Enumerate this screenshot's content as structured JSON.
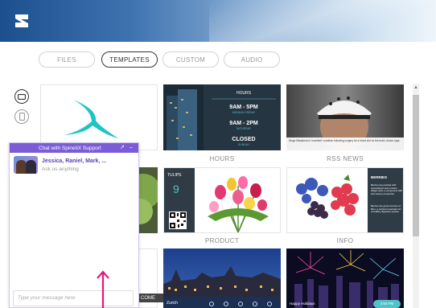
{
  "tabs": [
    {
      "label": "FILES",
      "active": false
    },
    {
      "label": "TEMPLATES",
      "active": true
    },
    {
      "label": "CUSTOM",
      "active": false
    },
    {
      "label": "AUDIO",
      "active": false
    }
  ],
  "side_icons": [
    "landscape-screen-icon",
    "portrait-screen-icon"
  ],
  "thumbs": {
    "hours": {
      "caption": "HOURS",
      "title": "HOURS",
      "row1": "9AM - 5PM",
      "row1_sub": "MONDAY-FRIDAY",
      "row2": "9AM - 2PM",
      "row2_sub": "SATURDAY",
      "row3": "CLOSED",
      "row3_sub": "SUNDAY"
    },
    "rss": {
      "caption": "RSS NEWS",
      "headline": "Diego Maradona in 'excellent' condition following surgery for a blood clot on the brain, doctor says"
    },
    "product": {
      "caption": "PRODUCT",
      "label": "TULIPS",
      "number": "9"
    },
    "info": {
      "caption": "INFO",
      "title": "BERRIES",
      "para1": "Berries are packed with antioxidants and contain ellagic acid, a compound with anti-cancer properties",
      "para2": "Berries are great sources of fiber, a nutrient important for a healthy digestive system."
    },
    "city": {
      "label": "Zurich"
    },
    "fireworks": {
      "label": "Happy Holidays",
      "time": "3:50 PM"
    }
  },
  "partial_label": "COME",
  "chat": {
    "title": "Chat with SpinetiX Support",
    "agents": "Jessica, Raniel, Mark, ...",
    "subtitle": "Ask us anything",
    "placeholder": "Type your message here"
  },
  "colors": {
    "accent": "#7c5cd6",
    "teal": "#4fc3c8",
    "arrow": "#e0177d",
    "dark_panel": "#2f3b45"
  }
}
